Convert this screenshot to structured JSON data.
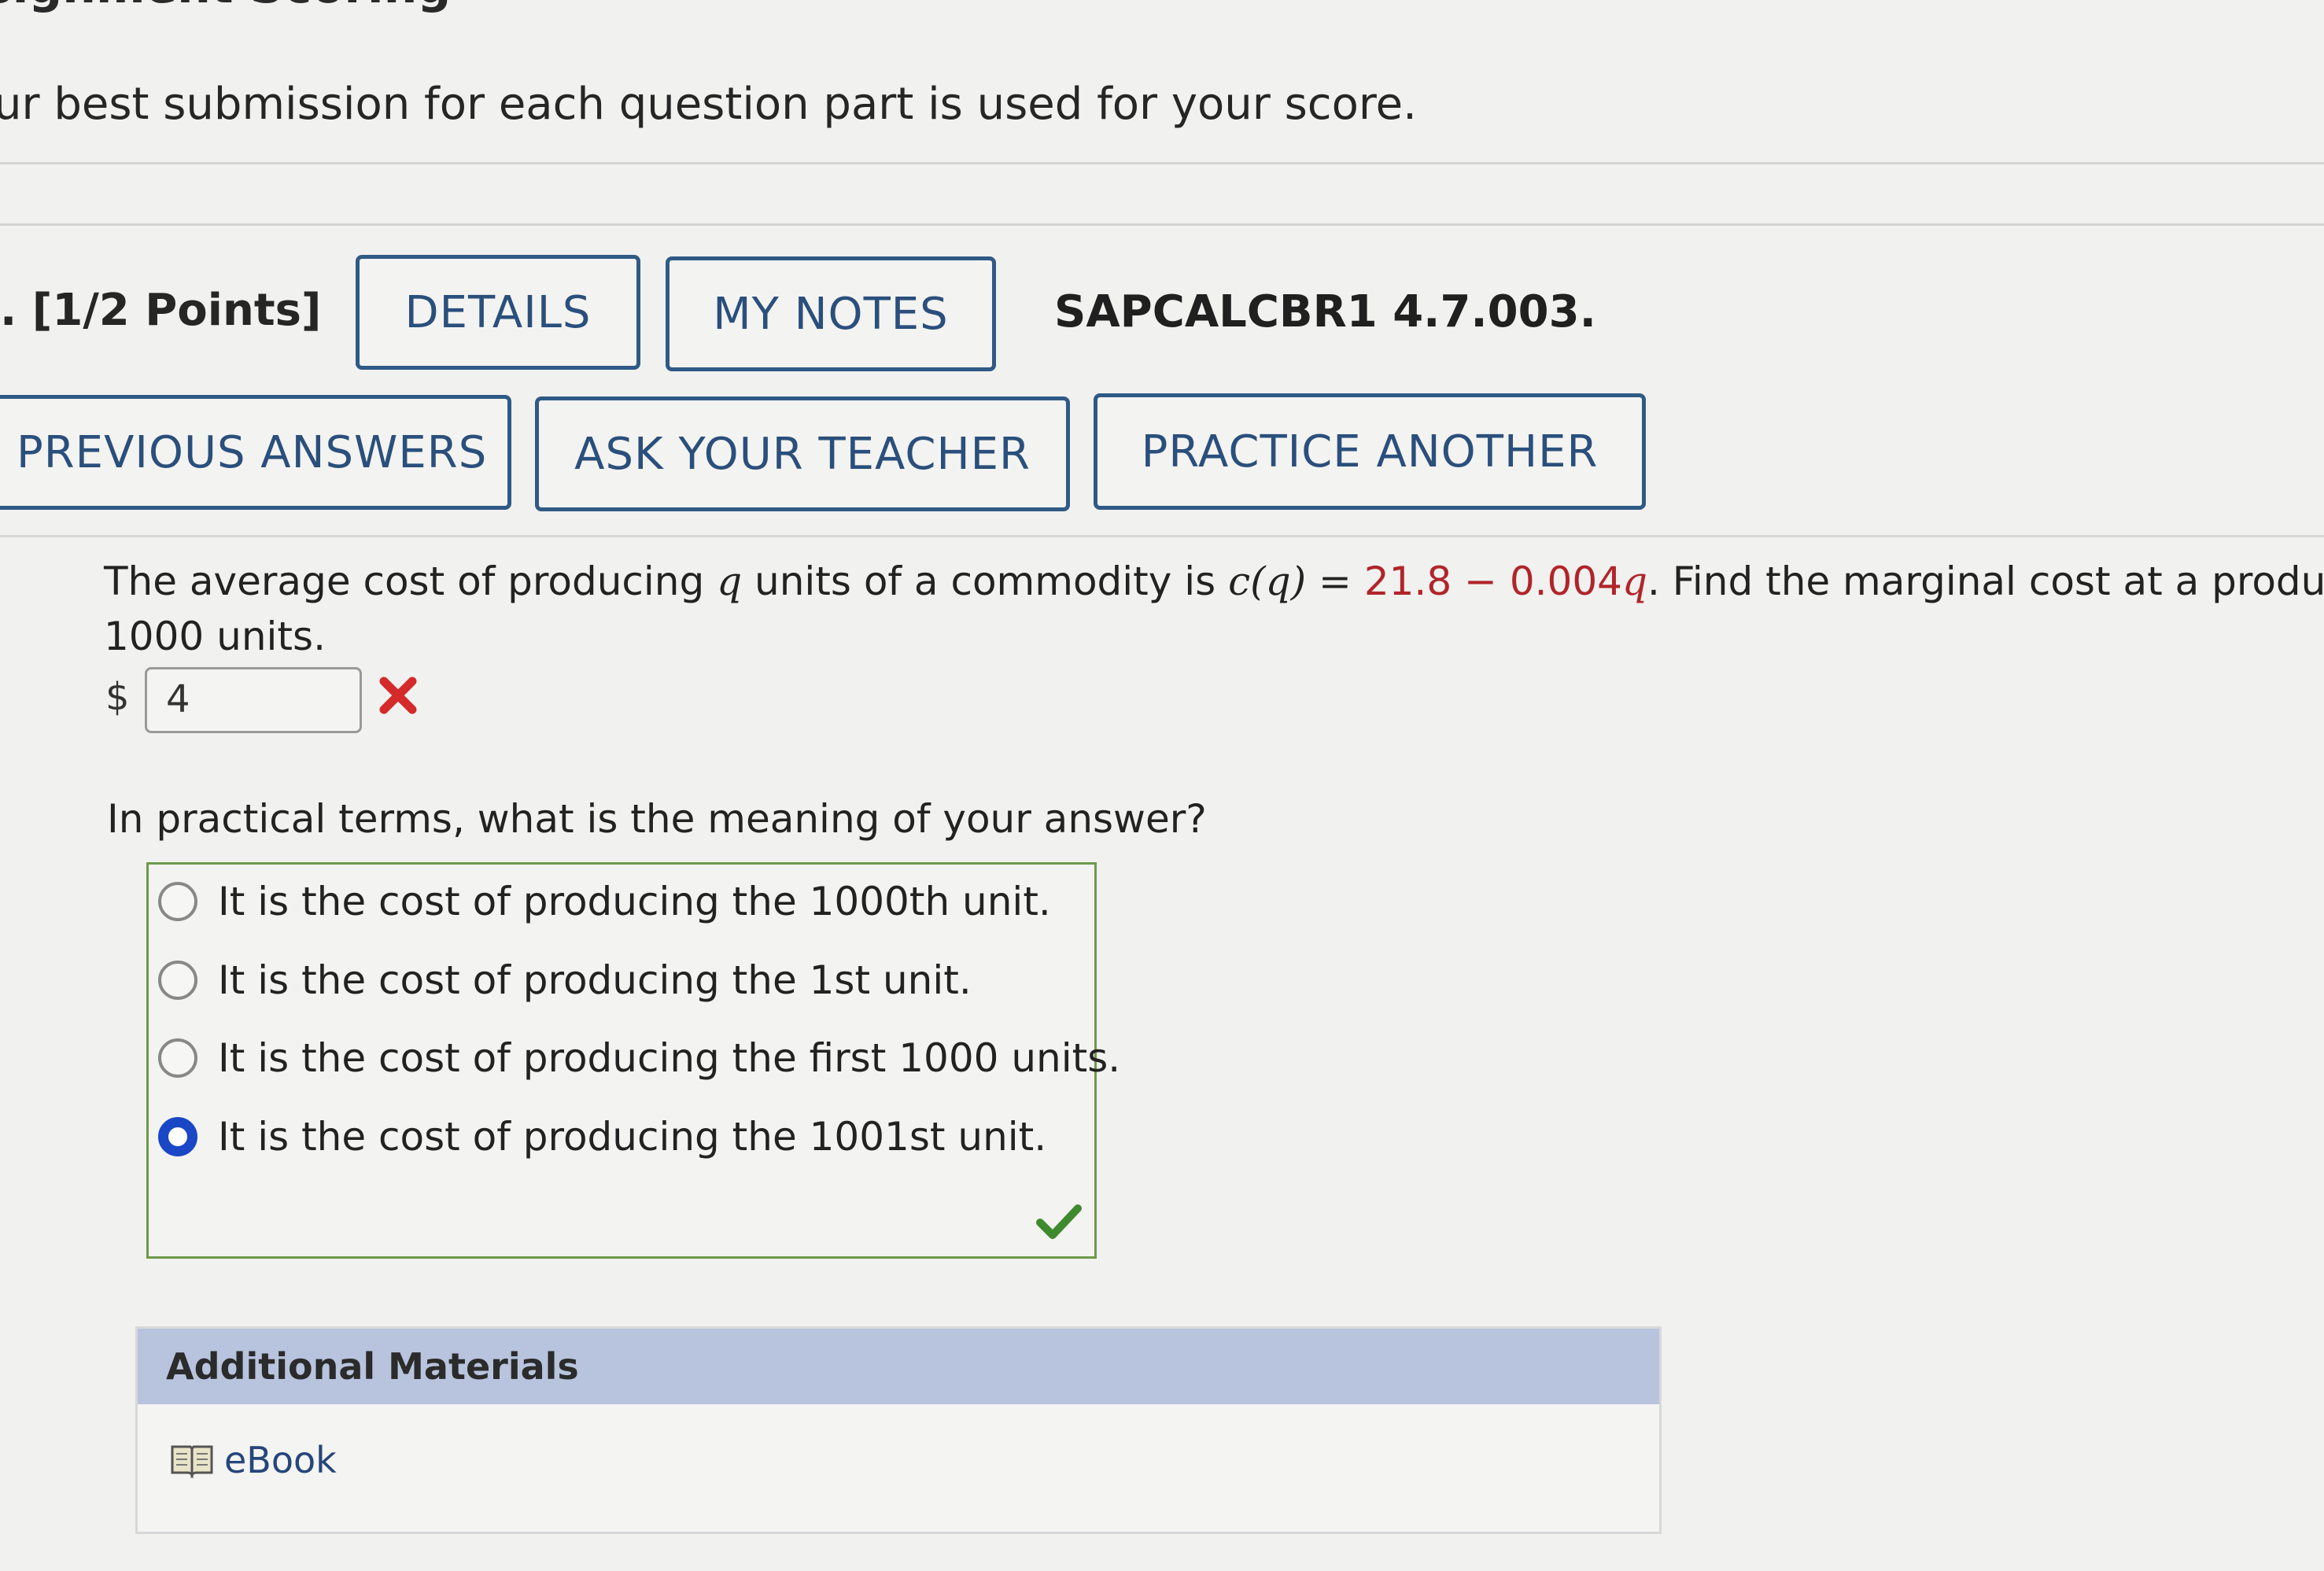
{
  "header": {
    "heading_partial": "signment Scoring",
    "intro_text": "ur best submission for each question part is used for your score."
  },
  "question": {
    "points": ". [1/2 Points]",
    "details_label": "DETAILS",
    "my_notes_label": "MY NOTES",
    "question_id": "SAPCALCBR1 4.7.003.",
    "previous_answers_label": "PREVIOUS ANSWERS",
    "ask_teacher_label": "ASK YOUR TEACHER",
    "practice_another_label": "PRACTICE ANOTHER",
    "prompt_part1": "The average cost of producing ",
    "prompt_var": "q",
    "prompt_part2": " units of a commodity is ",
    "formula_lhs": "c(q) = ",
    "formula_rhs_red": "21.8 − 0.004",
    "formula_var": "q",
    "prompt_part3": ".  Find the marginal cost at a productio",
    "prompt_line2": "1000 units.",
    "currency_symbol": "$",
    "answer_value": "4",
    "answer_status": "incorrect",
    "practical_question": "In practical terms, what is the meaning of your answer?",
    "choices": [
      {
        "label": "It is the cost of producing the 1000th unit.",
        "selected": false
      },
      {
        "label": "It is the cost of producing the 1st unit.",
        "selected": false
      },
      {
        "label": "It is the cost of producing the first 1000 units.",
        "selected": false
      },
      {
        "label": "It is the cost of producing the 1001st unit.",
        "selected": true
      }
    ],
    "choice_status": "correct"
  },
  "additional_materials": {
    "title": "Additional Materials",
    "ebook_label": "eBook"
  },
  "colors": {
    "button_border": "#2f5a85",
    "formula_red": "#b0252a",
    "incorrect_red": "#d42a2a",
    "correct_green": "#3f8a2e",
    "radio_selected": "#1a47c6",
    "materials_header": "#b8c4de"
  },
  "icons": {
    "incorrect": "x-mark-icon",
    "correct": "check-mark-icon",
    "ebook": "book-icon"
  }
}
